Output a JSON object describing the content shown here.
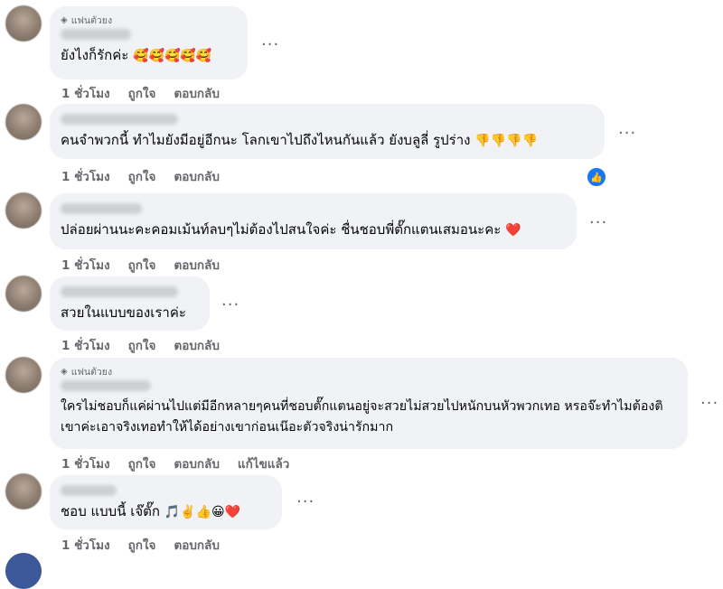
{
  "comments": [
    {
      "badge": "แฟนตัวยง",
      "text": "ยังไงก็รักค่ะ",
      "emojis": "🥰🥰🥰🥰🥰",
      "actions": [
        "1 ชั่วโมง",
        "ถูกใจ",
        "ตอบกลับ"
      ]
    },
    {
      "text": "คนจำพวกนี้ ทำไมยังมีอยู่อีกนะ โลกเขาไปถึงไหนกันแล้ว ยังบลูลี่ รูปร่าง",
      "emojis": "👎👎👎👎",
      "actions": [
        "1 ชั่วโมง",
        "ถูกใจ",
        "ตอบกลับ"
      ]
    },
    {
      "text": "ปล่อยผ่านนะคะคอมเม้นท์ลบๆไม่ต้องไปสนใจค่ะ ชื่นชอบพี่ตั๊กแตนเสมอนะคะ",
      "emojis": "❤️",
      "actions": [
        "1 ชั่วโมง",
        "ถูกใจ",
        "ตอบกลับ"
      ]
    },
    {
      "text": "สวยในแบบของเราค่ะ",
      "emojis": "",
      "actions": [
        "1 ชั่วโมง",
        "ถูกใจ",
        "ตอบกลับ"
      ]
    },
    {
      "badge": "แฟนตัวยง",
      "text": "ใครไม่ชอบก็แค่ผ่านไปแต่มีอีกหลายๆคนที่ชอบตั๊กแตนอยู่จะสวยไม่สวยไปหนักบนหัวพวกเทอ หรอจ๊ะทำไมต้องติเขาค่ะเอาจริงเทอทำให้ได้อย่างเขาก่อนเน๊อะตัวจริงน่ารักมาก",
      "emojis": "",
      "actions": [
        "1 ชั่วโมง",
        "ถูกใจ",
        "ตอบกลับ",
        "แก้ไขแล้ว"
      ]
    },
    {
      "text": "ชอบ แบบนี้ เจ๊ตั๊ก",
      "emojis": "🎵✌️👍😀❤️",
      "actions": [
        "1 ชั่วโมง",
        "ถูกใจ",
        "ตอบกลับ"
      ]
    }
  ],
  "more_label": "···",
  "like_icon": "thumbs-up-icon",
  "colors": {
    "bubble": "#f0f2f5",
    "muted": "#65676b",
    "like": "#1877f2"
  }
}
